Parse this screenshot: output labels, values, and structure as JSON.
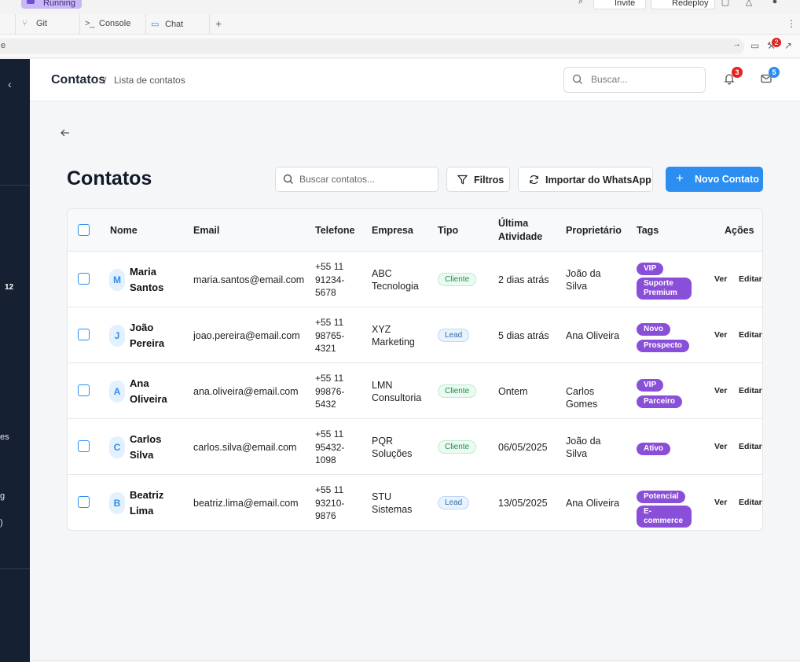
{
  "chrome": {
    "run_label": "Running",
    "invite_label": "Invite",
    "redeploy_label": "Redeploy",
    "tabs": [
      {
        "label": "Git",
        "icon": "git-branch-icon"
      },
      {
        "label": "Console",
        "icon": "terminal-icon"
      },
      {
        "label": "Chat",
        "icon": "chat-icon"
      }
    ],
    "url_text": "e",
    "extension_badge": "2"
  },
  "sidebar": {
    "count": "12",
    "fragments": [
      "es",
      "g",
      ")"
    ]
  },
  "header": {
    "breadcrumb_main": "Contatos",
    "breadcrumb_sep": "/",
    "breadcrumb_sub": "Lista de contatos",
    "search_placeholder": "Buscar...",
    "notifications_count": "3",
    "messages_count": "5"
  },
  "page": {
    "title": "Contatos",
    "search_placeholder": "Buscar contatos...",
    "filters_label": "Filtros",
    "import_label": "Importar do WhatsApp",
    "new_label": "Novo Contato"
  },
  "table": {
    "headers": {
      "name": "Nome",
      "email": "Email",
      "phone": "Telefone",
      "company": "Empresa",
      "type": "Tipo",
      "last_activity": "Última Atividade",
      "owner": "Proprietário",
      "tags": "Tags",
      "actions": "Ações"
    },
    "view_label": "Ver",
    "edit_label": "Editar",
    "rows": [
      {
        "initial": "M",
        "name": "Maria Santos",
        "email": "maria.santos@email.com",
        "phone": "+55 11 91234-5678",
        "company": "ABC Tecnologia",
        "type": "Cliente",
        "type_class": "cliente",
        "last_activity": "2 dias atrás",
        "owner": "João da Silva",
        "tags": [
          "VIP",
          "Suporte Premium"
        ]
      },
      {
        "initial": "J",
        "name": "João Pereira",
        "email": "joao.pereira@email.com",
        "phone": "+55 11 98765-4321",
        "company": "XYZ Marketing",
        "type": "Lead",
        "type_class": "lead",
        "last_activity": "5 dias atrás",
        "owner": "Ana Oliveira",
        "tags": [
          "Novo",
          "Prospecto"
        ]
      },
      {
        "initial": "A",
        "name": "Ana Oliveira",
        "email": "ana.oliveira@email.com",
        "phone": "+55 11 99876-5432",
        "company": "LMN Consultoria",
        "type": "Cliente",
        "type_class": "cliente",
        "last_activity": "Ontem",
        "owner": "Carlos Gomes",
        "tags": [
          "VIP",
          "Parceiro"
        ]
      },
      {
        "initial": "C",
        "name": "Carlos Silva",
        "email": "carlos.silva@email.com",
        "phone": "+55 11 95432-1098",
        "company": "PQR Soluções",
        "type": "Cliente",
        "type_class": "cliente",
        "last_activity": "06/05/2025",
        "owner": "João da Silva",
        "tags": [
          "Ativo"
        ]
      },
      {
        "initial": "B",
        "name": "Beatriz Lima",
        "email": "beatriz.lima@email.com",
        "phone": "+55 11 93210-9876",
        "company": "STU Sistemas",
        "type": "Lead",
        "type_class": "lead",
        "last_activity": "13/05/2025",
        "owner": "Ana Oliveira",
        "tags": [
          "Potencial",
          "E-commerce"
        ]
      }
    ]
  },
  "colors": {
    "primary": "#2b8ef0",
    "tag_purple": "#8a4fd8",
    "sidebar_bg": "#152033",
    "badge_red": "#e02424"
  }
}
